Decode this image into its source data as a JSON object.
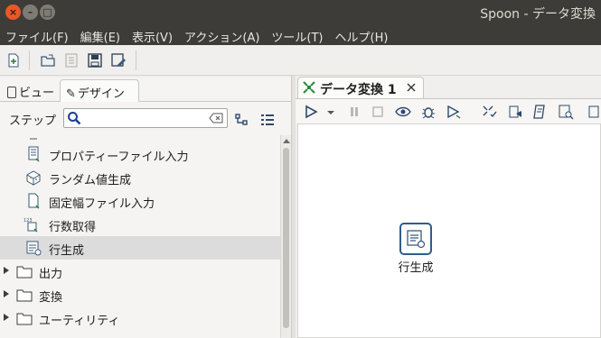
{
  "window": {
    "title": "Spoon - データ変換"
  },
  "menu": [
    "ファイル(F)",
    "編集(E)",
    "表示(V)",
    "アクション(A)",
    "ツール(T)",
    "ヘルプ(H)"
  ],
  "left": {
    "tab_view": "ビュー",
    "tab_design": "デザイン",
    "step_label": "ステップ",
    "search_value": "",
    "tree": [
      {
        "label": "プロパティーファイル入力",
        "type": "step",
        "icon": "properties-file-icon"
      },
      {
        "label": "ランダム値生成",
        "type": "step",
        "icon": "random-value-icon"
      },
      {
        "label": "固定幅ファイル入力",
        "type": "step",
        "icon": "fixed-file-icon"
      },
      {
        "label": "行数取得",
        "type": "step",
        "icon": "row-count-icon"
      },
      {
        "label": "行生成",
        "type": "step",
        "icon": "generate-rows-icon",
        "selected": true
      },
      {
        "label": "出力",
        "type": "folder",
        "icon": "folder-icon"
      },
      {
        "label": "変換",
        "type": "folder",
        "icon": "folder-icon"
      },
      {
        "label": "ユーティリティ",
        "type": "folder",
        "icon": "folder-icon"
      }
    ]
  },
  "right": {
    "tab_title": "データ変換 1",
    "canvas_step": "行生成"
  },
  "colors": {
    "accent": "#2f5c8a",
    "titlebar": "#3d3c38",
    "close": "#e8582a"
  }
}
